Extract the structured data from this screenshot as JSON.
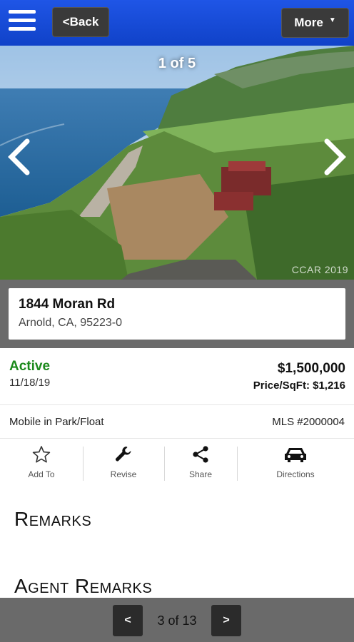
{
  "header": {
    "back_label": "<Back",
    "more_label": "More",
    "menu_icon": "hamburger-menu-icon"
  },
  "photo": {
    "counter": "1 of 5",
    "watermark": "CCAR 2019"
  },
  "address": {
    "street": "1844 Moran Rd",
    "city_line": "Arnold, CA, 95223-0"
  },
  "status": {
    "label": "Active",
    "date": "11/18/19",
    "price": "$1,500,000",
    "price_per_sqft": "Price/SqFt: $1,216",
    "color": "#1c8a1c"
  },
  "details": {
    "property_type": "Mobile in Park/Float",
    "mls": "MLS #2000004"
  },
  "actions": [
    {
      "label": "Add To",
      "icon": "star-icon"
    },
    {
      "label": "Revise",
      "icon": "wrench-icon"
    },
    {
      "label": "Share",
      "icon": "share-icon"
    },
    {
      "label": "Directions",
      "icon": "car-icon"
    }
  ],
  "sections": {
    "remarks": "Remarks",
    "agent_remarks": "Agent Remarks"
  },
  "pager": {
    "prev": "<",
    "text": "3 of 13",
    "next": ">"
  },
  "colors": {
    "header": "#1a4fe0",
    "dark_button": "#3a3a3a",
    "panel_gray": "#6b6b6b"
  }
}
